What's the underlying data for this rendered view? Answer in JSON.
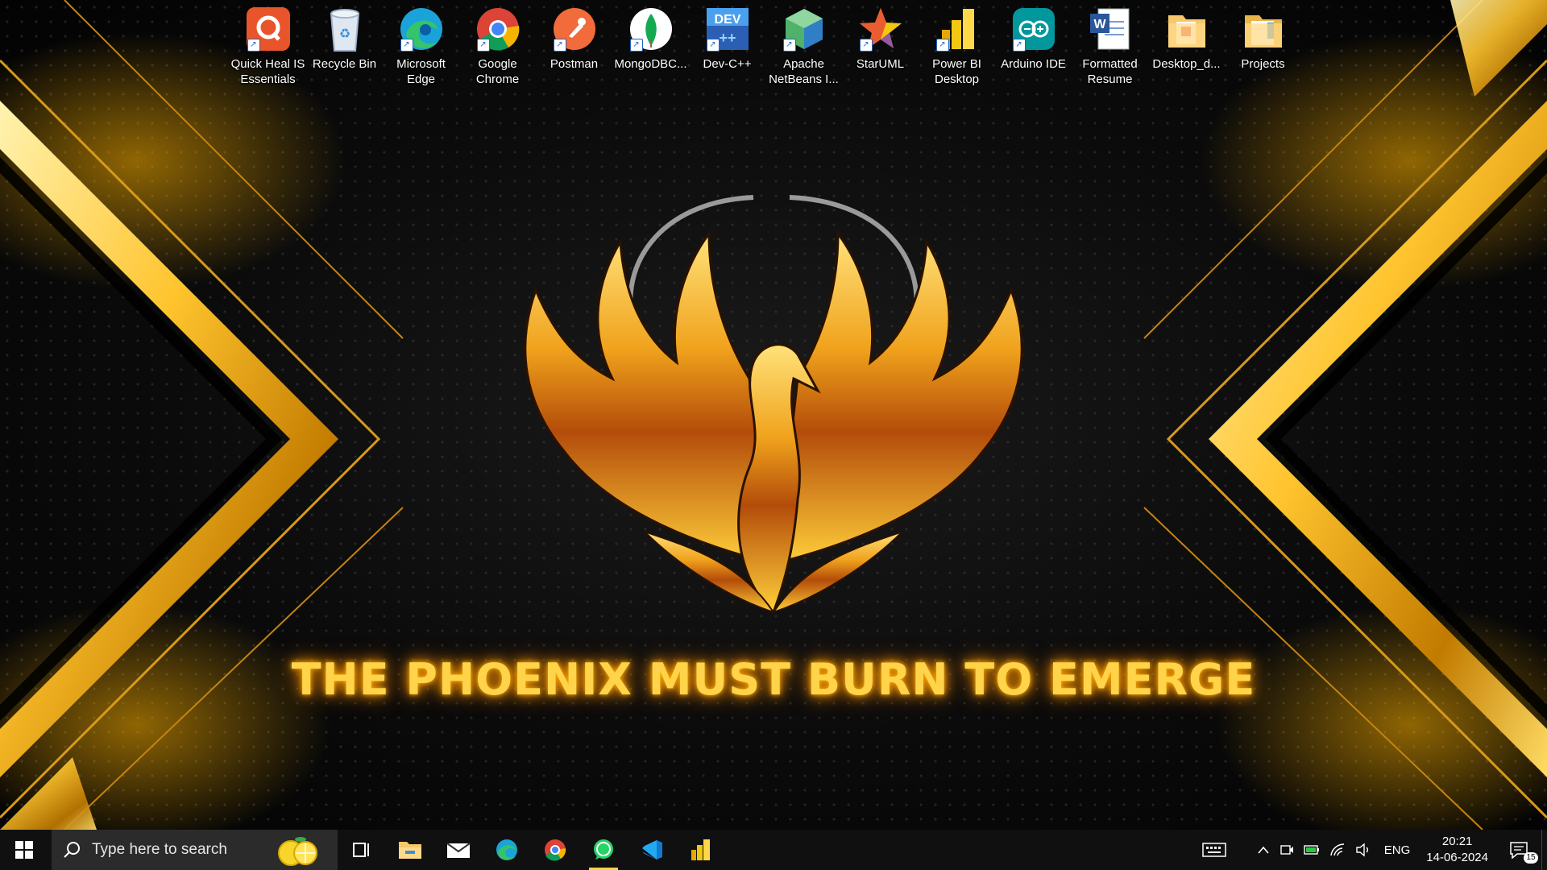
{
  "desktop": {
    "icons": [
      {
        "label": "Quick Heal IS Essentials",
        "icon": "quick-heal-icon",
        "color": "#e9552b"
      },
      {
        "label": "Recycle Bin",
        "icon": "recycle-bin-icon",
        "color": "#c9d6e6"
      },
      {
        "label": "Microsoft Edge",
        "icon": "edge-icon",
        "color": "#1aa3d9"
      },
      {
        "label": "Google Chrome",
        "icon": "chrome-icon",
        "color": "#db4437"
      },
      {
        "label": "Postman",
        "icon": "postman-icon",
        "color": "#f26b3a"
      },
      {
        "label": "MongoDBC...",
        "icon": "mongodb-compass-icon",
        "color": "#13aa52"
      },
      {
        "label": "Dev-C++",
        "icon": "dev-cpp-icon",
        "color": "#2b5fb4"
      },
      {
        "label": "Apache NetBeans I...",
        "icon": "netbeans-icon",
        "color": "#4fb16a"
      },
      {
        "label": "StarUML",
        "icon": "staruml-icon",
        "color": "#e8423a"
      },
      {
        "label": "Power BI Desktop",
        "icon": "power-bi-icon",
        "color": "#f2c811"
      },
      {
        "label": "Arduino IDE",
        "icon": "arduino-icon",
        "color": "#00979d"
      },
      {
        "label": "Formatted Resume",
        "icon": "word-document-icon",
        "color": "#2b579a"
      },
      {
        "label": "Desktop_d...",
        "icon": "folder-icon",
        "color": "#f5c86a"
      },
      {
        "label": "Projects",
        "icon": "folder-icon",
        "color": "#f5c86a"
      }
    ],
    "wallpaper_text": "THE PHOENIX MUST BURN TO EMERGE",
    "accent_gold": "#ffc42e"
  },
  "taskbar": {
    "search_placeholder": "Type here to search",
    "pinned": [
      {
        "name": "task-view",
        "icon": "task-view-icon"
      },
      {
        "name": "file-explorer",
        "icon": "folder-icon"
      },
      {
        "name": "mail",
        "icon": "mail-icon"
      },
      {
        "name": "edge",
        "icon": "edge-icon"
      },
      {
        "name": "chrome",
        "icon": "chrome-icon"
      },
      {
        "name": "whatsapp",
        "icon": "whatsapp-icon",
        "running": true
      },
      {
        "name": "vscode",
        "icon": "vscode-icon"
      },
      {
        "name": "power-bi",
        "icon": "power-bi-icon"
      }
    ],
    "tray": {
      "language": "ENG",
      "time": "20:21",
      "date": "14-06-2024",
      "notification_count": "15"
    }
  }
}
